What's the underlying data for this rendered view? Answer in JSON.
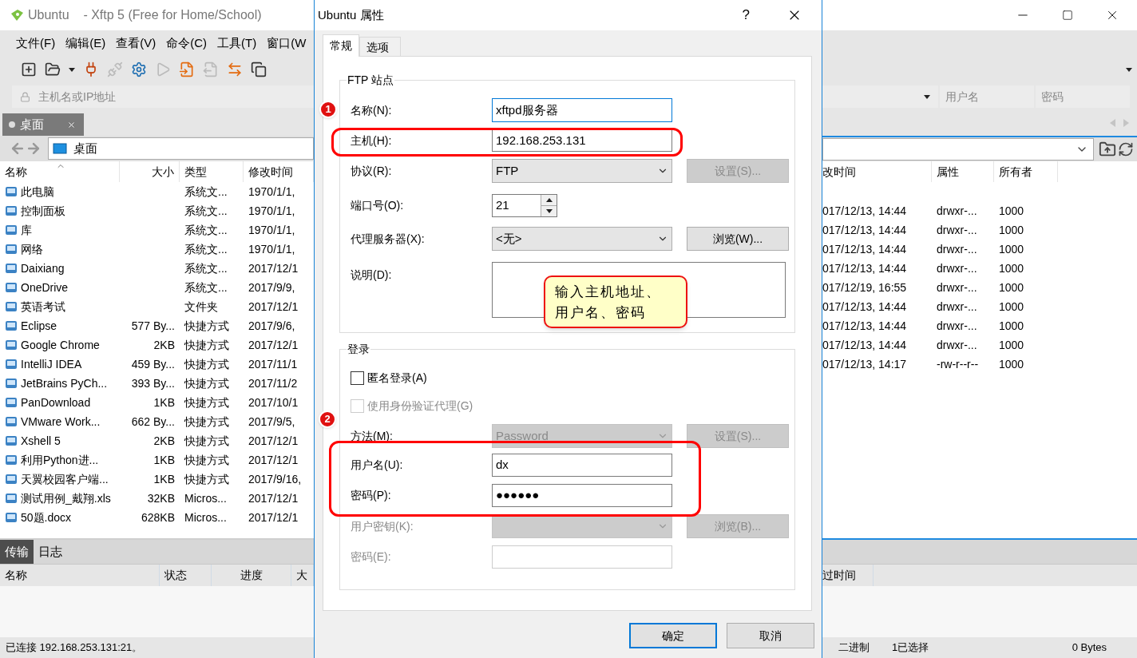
{
  "window": {
    "title": "Ubuntu    - Xftp 5 (Free for Home/School)"
  },
  "menu": [
    "文件(F)",
    "编辑(E)",
    "查看(V)",
    "命令(C)",
    "工具(T)",
    "窗口(W"
  ],
  "address_bar": {
    "host_placeholder": "主机名或IP地址",
    "user_placeholder": "用户名",
    "password_placeholder": "密码"
  },
  "local_pane": {
    "tab": {
      "label": "桌面",
      "selected": true
    },
    "path": "桌面",
    "columns": [
      "名称",
      "大小",
      "类型",
      "修改时间"
    ],
    "rows": [
      {
        "name": "此电脑",
        "size": "",
        "type": "系统文...",
        "modified": "1970/1/1,"
      },
      {
        "name": "控制面板",
        "size": "",
        "type": "系统文...",
        "modified": "1970/1/1,"
      },
      {
        "name": "库",
        "size": "",
        "type": "系统文...",
        "modified": "1970/1/1,"
      },
      {
        "name": "网络",
        "size": "",
        "type": "系统文...",
        "modified": "1970/1/1,"
      },
      {
        "name": "Daixiang",
        "size": "",
        "type": "系统文...",
        "modified": "2017/12/1"
      },
      {
        "name": "OneDrive",
        "size": "",
        "type": "系统文...",
        "modified": "2017/9/9,"
      },
      {
        "name": "英语考试",
        "size": "",
        "type": "文件夹",
        "modified": "2017/12/1"
      },
      {
        "name": "Eclipse",
        "size": "577 By...",
        "type": "快捷方式",
        "modified": "2017/9/6,"
      },
      {
        "name": "Google Chrome",
        "size": "2KB",
        "type": "快捷方式",
        "modified": "2017/12/1"
      },
      {
        "name": "IntelliJ IDEA",
        "size": "459 By...",
        "type": "快捷方式",
        "modified": "2017/11/1"
      },
      {
        "name": "JetBrains PyCh...",
        "size": "393 By...",
        "type": "快捷方式",
        "modified": "2017/11/2"
      },
      {
        "name": "PanDownload",
        "size": "1KB",
        "type": "快捷方式",
        "modified": "2017/10/1"
      },
      {
        "name": "VMware Work...",
        "size": "662 By...",
        "type": "快捷方式",
        "modified": "2017/9/5,"
      },
      {
        "name": "Xshell 5",
        "size": "2KB",
        "type": "快捷方式",
        "modified": "2017/12/1"
      },
      {
        "name": "利用Python进...",
        "size": "1KB",
        "type": "快捷方式",
        "modified": "2017/12/1"
      },
      {
        "name": "天翼校园客户端...",
        "size": "1KB",
        "type": "快捷方式",
        "modified": "2017/9/16,"
      },
      {
        "name": "测试用例_戴翔.xls",
        "size": "32KB",
        "type": "Micros...",
        "modified": "2017/12/1"
      },
      {
        "name": "50题.docx",
        "size": "628KB",
        "type": "Micros...",
        "modified": "2017/12/1"
      }
    ]
  },
  "remote_pane": {
    "columns": [
      "改时间",
      "属性",
      "所有者"
    ],
    "rows": [
      {
        "modified": "017/12/13, 14:44",
        "attributes": "drwxr-...",
        "owner": "1000"
      },
      {
        "modified": "017/12/13, 14:44",
        "attributes": "drwxr-...",
        "owner": "1000"
      },
      {
        "modified": "017/12/13, 14:44",
        "attributes": "drwxr-...",
        "owner": "1000"
      },
      {
        "modified": "017/12/13, 14:44",
        "attributes": "drwxr-...",
        "owner": "1000"
      },
      {
        "modified": "017/12/19, 16:55",
        "attributes": "drwxr-...",
        "owner": "1000"
      },
      {
        "modified": "017/12/13, 14:44",
        "attributes": "drwxr-...",
        "owner": "1000"
      },
      {
        "modified": "017/12/13, 14:44",
        "attributes": "drwxr-...",
        "owner": "1000"
      },
      {
        "modified": "017/12/13, 14:44",
        "attributes": "drwxr-...",
        "owner": "1000"
      },
      {
        "modified": "017/12/13, 14:17",
        "attributes": "-rw-r--r--",
        "owner": "1000"
      }
    ]
  },
  "transfer_panel": {
    "tabs": [
      {
        "label": "传输",
        "selected": true
      },
      {
        "label": "日志",
        "selected": false
      }
    ],
    "columns": [
      "名称",
      "状态",
      "进度",
      "大"
    ],
    "right_columns": [
      "过时间"
    ]
  },
  "status_bar": {
    "connection": "已连接 192.168.253.131:21。",
    "mode": "二进制",
    "selection": "1已选择",
    "size": "0 Bytes"
  },
  "dialog": {
    "title": "Ubuntu 属性",
    "help": "?",
    "tabs": [
      {
        "label": "常规",
        "selected": true
      },
      {
        "label": "选项",
        "selected": false
      }
    ],
    "site_group": {
      "legend": "FTP 站点",
      "fields": [
        {
          "kind": "text",
          "label": "名称(N):",
          "value": "xftpd服务器",
          "focused": true,
          "disabled": false
        },
        {
          "kind": "text",
          "label": "主机(H):",
          "value": "192.168.253.131",
          "focused": false,
          "disabled": false
        },
        {
          "kind": "select",
          "label": "协议(R):",
          "value": "FTP",
          "disabled": false,
          "button": {
            "label": "设置(S)...",
            "disabled": true
          }
        },
        {
          "kind": "spinner",
          "label": "端口号(O):",
          "value": "21"
        },
        {
          "kind": "select",
          "label": "代理服务器(X):",
          "value": "<无>",
          "disabled": false,
          "button": {
            "label": "浏览(W)...",
            "disabled": false
          }
        },
        {
          "kind": "textarea",
          "label": "说明(D):"
        }
      ]
    },
    "login_group": {
      "legend": "登录",
      "fields": [
        {
          "kind": "checkbox",
          "label": "匿名登录(A)",
          "checked": false,
          "disabled": false
        },
        {
          "kind": "checkbox",
          "label": "使用身份验证代理(G)",
          "checked": false,
          "disabled": true
        },
        {
          "kind": "select",
          "label": "方法(M):",
          "value": "Password",
          "disabled": true,
          "button": {
            "label": "设置(S)...",
            "disabled": true
          }
        },
        {
          "kind": "text",
          "label": "用户名(U):",
          "value": "dx",
          "focused": false,
          "disabled": false
        },
        {
          "kind": "text",
          "label": "密码(P):",
          "value": "●●●●●●",
          "focused": false,
          "disabled": false
        },
        {
          "kind": "select",
          "label": "用户密钥(K):",
          "disabled": true,
          "button": {
            "label": "浏览(B)...",
            "disabled": true
          }
        },
        {
          "kind": "text",
          "label": "密码(E):",
          "focused": false,
          "disabled": true
        }
      ]
    },
    "buttons": [
      {
        "label": "确定",
        "default": true
      },
      {
        "label": "取消",
        "default": false
      }
    ]
  },
  "annotations": {
    "badges": [
      "1",
      "2"
    ],
    "callout": [
      "输入主机地址、",
      "用户名、密码"
    ]
  }
}
